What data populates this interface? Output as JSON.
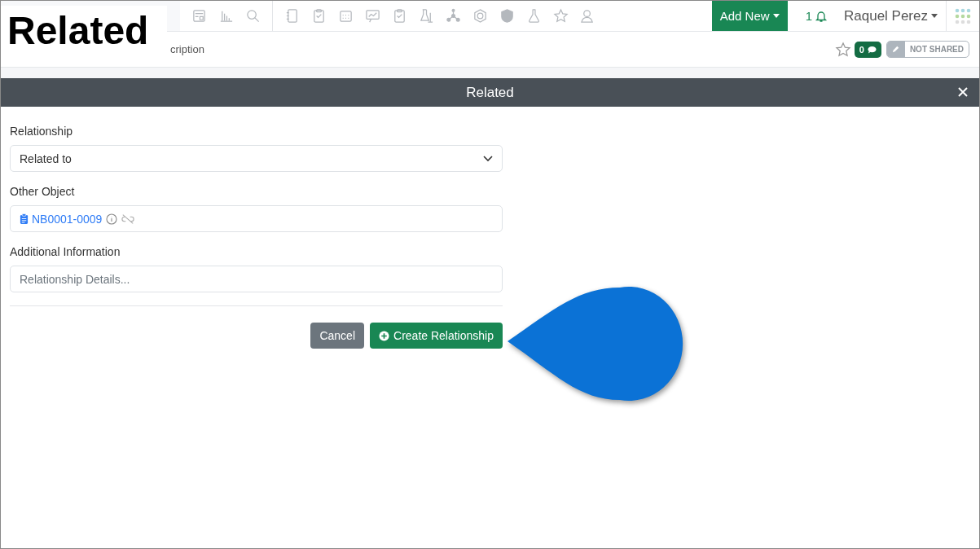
{
  "caption": "Related",
  "navbar": {
    "add_new": "Add New",
    "notification_count": "1",
    "user": "Raquel Perez"
  },
  "subbar": {
    "breadcrumb": "cription",
    "comment_count": "0",
    "share_status": "NOT SHARED"
  },
  "modal": {
    "title": "Related",
    "fields": [
      {
        "kind": "select",
        "label": "Relationship",
        "value": "Related to"
      },
      {
        "kind": "object",
        "label": "Other Object",
        "value": "NB0001-0009"
      },
      {
        "kind": "text",
        "label": "Additional Information",
        "placeholder": "Relationship Details..."
      }
    ],
    "buttons": [
      {
        "kind": "secondary",
        "label": "Cancel"
      },
      {
        "kind": "primary",
        "label": "Create Relationship"
      }
    ]
  }
}
